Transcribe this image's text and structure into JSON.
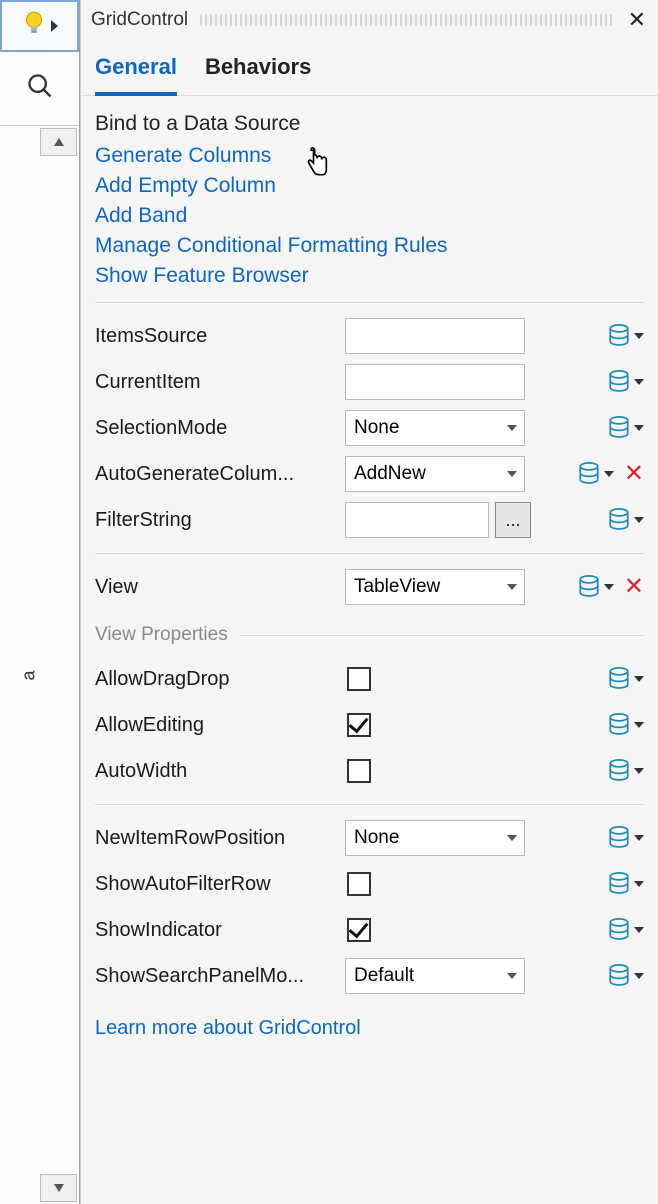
{
  "panel": {
    "title": "GridControl"
  },
  "tabs": [
    {
      "label": "General",
      "active": true
    },
    {
      "label": "Behaviors",
      "active": false
    }
  ],
  "actions": {
    "heading": "Bind to a Data Source",
    "links": [
      "Generate Columns",
      "Add Empty Column",
      "Add Band",
      "Manage Conditional Formatting Rules",
      "Show Feature Browser"
    ]
  },
  "props": {
    "itemsSource": {
      "label": "ItemsSource",
      "value": ""
    },
    "currentItem": {
      "label": "CurrentItem",
      "value": ""
    },
    "selectionMode": {
      "label": "SelectionMode",
      "value": "None"
    },
    "autoGenCols": {
      "label": "AutoGenerateColum...",
      "value": "AddNew",
      "reset": true
    },
    "filterString": {
      "label": "FilterString",
      "value": ""
    },
    "view": {
      "label": "View",
      "value": "TableView",
      "reset": true
    }
  },
  "viewSection": {
    "title": "View Properties"
  },
  "viewProps": {
    "allowDragDrop": {
      "label": "AllowDragDrop",
      "checked": false
    },
    "allowEditing": {
      "label": "AllowEditing",
      "checked": true
    },
    "autoWidth": {
      "label": "AutoWidth",
      "checked": false
    },
    "newItemRowPosition": {
      "label": "NewItemRowPosition",
      "value": "None"
    },
    "showAutoFilterRow": {
      "label": "ShowAutoFilterRow",
      "checked": false
    },
    "showIndicator": {
      "label": "ShowIndicator",
      "checked": true
    },
    "showSearchPanel": {
      "label": "ShowSearchPanelMo...",
      "value": "Default"
    }
  },
  "footer": {
    "learnMore": "Learn more about GridControl"
  },
  "ellipsis": "...",
  "sideLabel": "a"
}
